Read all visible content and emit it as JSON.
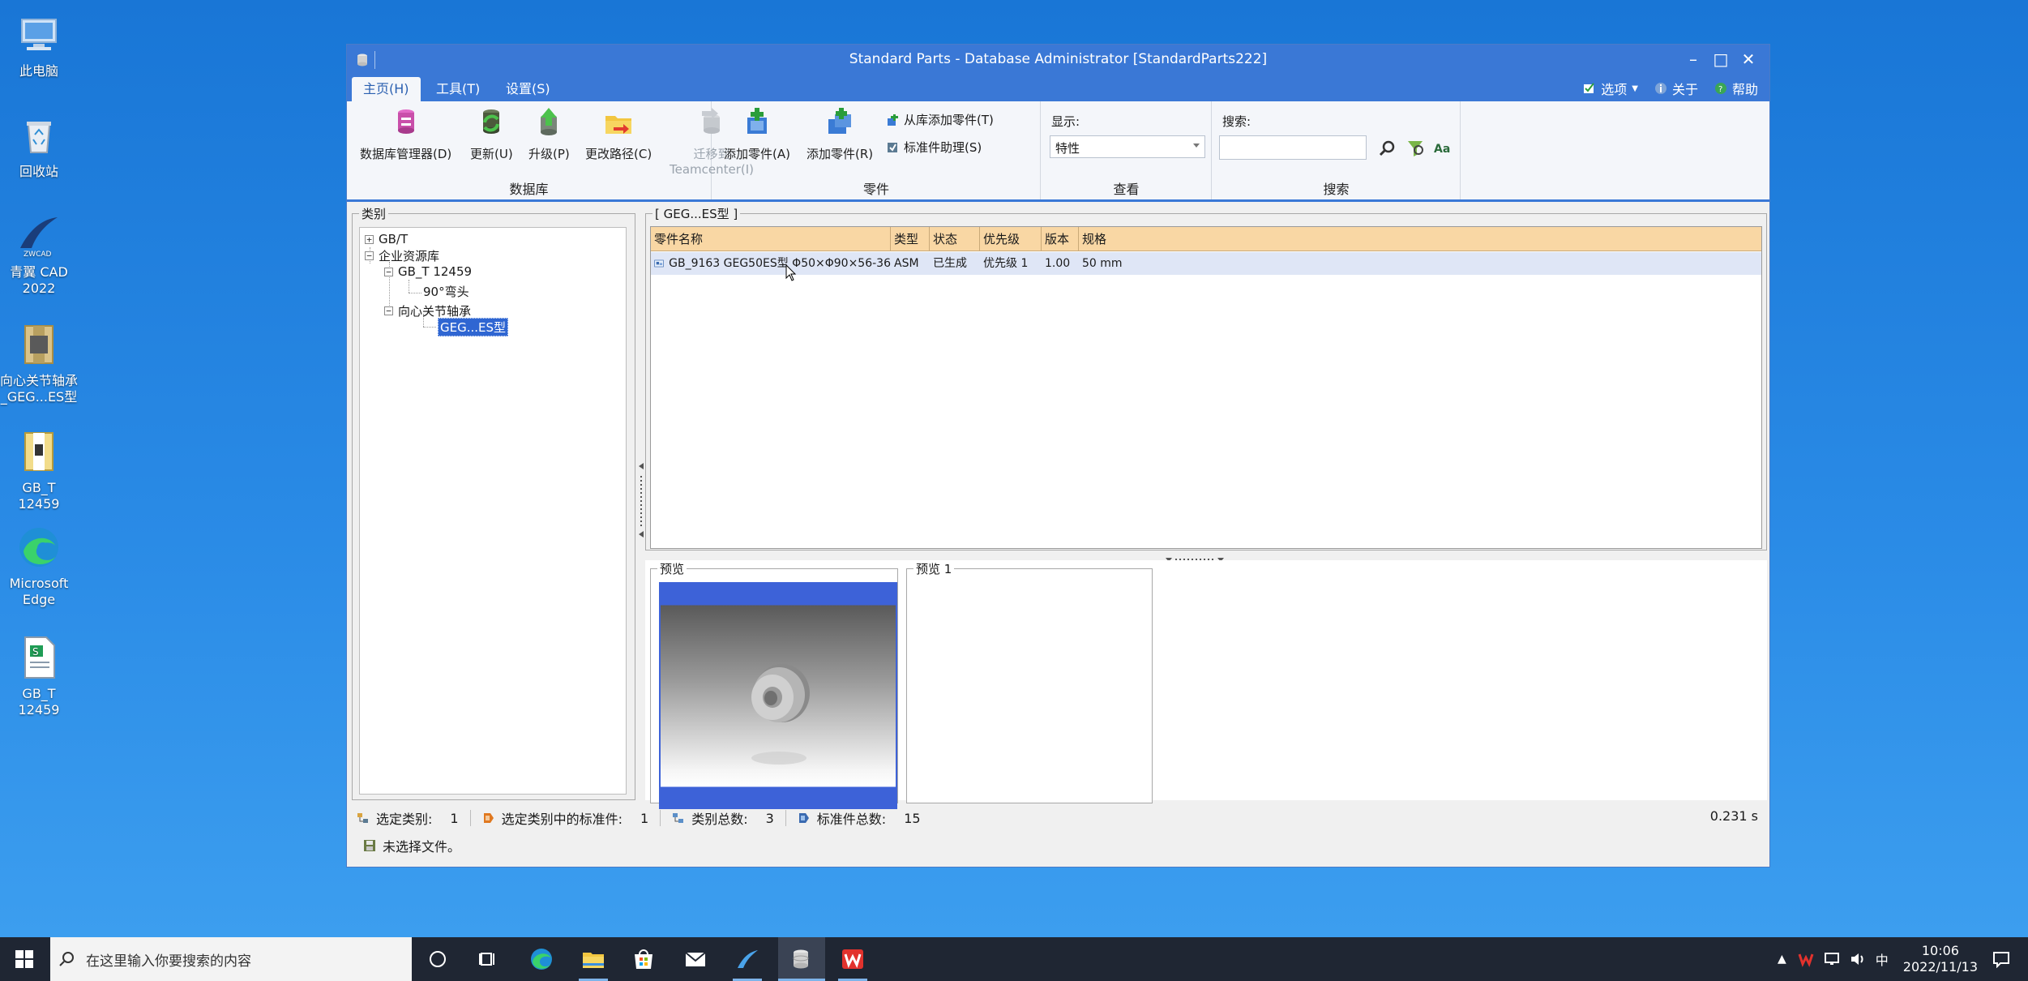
{
  "desktop": {
    "icons": [
      {
        "label": "此电脑",
        "icon": "computer-icon"
      },
      {
        "label": "回收站",
        "icon": "recycle-bin-icon"
      },
      {
        "label": "青翼 CAD 2022",
        "icon": "cad-app-icon"
      },
      {
        "label": "向心关节轴承_GEG...ES型",
        "icon": "archive-file-icon"
      },
      {
        "label": "GB_T 12459",
        "icon": "archive-file-icon"
      },
      {
        "label": "Microsoft Edge",
        "icon": "edge-icon"
      },
      {
        "label": "GB_T 12459",
        "icon": "spreadsheet-file-icon"
      }
    ]
  },
  "window": {
    "title": "Standard Parts - Database Administrator [StandardParts222]",
    "tabs": [
      "主页(H)",
      "工具(T)",
      "设置(S)"
    ],
    "active_tab": 0,
    "right_menu": {
      "options": "选项",
      "about": "关于",
      "help": "帮助"
    }
  },
  "ribbon": {
    "database": {
      "label": "数据库",
      "buttons": {
        "manager": "数据库管理器(D)",
        "update": "更新(U)",
        "upgrade": "升级(P)",
        "change_path": "更改路径(C)",
        "migrate_line1": "迁移到",
        "migrate_line2": "Teamcenter(I)"
      }
    },
    "parts": {
      "label": "零件",
      "add_part_a": "添加零件(A)",
      "add_part_r": "添加零件(R)",
      "add_from_lib": "从库添加零件(T)",
      "std_assistant": "标准件助理(S)"
    },
    "view": {
      "label": "查看",
      "display_label": "显示:",
      "display_value": "特性"
    },
    "search": {
      "label": "搜索",
      "search_label": "搜索:",
      "value": ""
    }
  },
  "category": {
    "title": "类别",
    "tree": {
      "gbt": "GB/T",
      "enterprise": "企业资源库",
      "gbt12459": "GB_T 12459",
      "elbow": "90°弯头",
      "bearing": "向心关节轴承",
      "geg": "GEG...ES型"
    }
  },
  "parts_list": {
    "title": "[ GEG...ES型 ]",
    "columns": [
      "零件名称",
      "类型",
      "状态",
      "优先级",
      "版本",
      "规格"
    ],
    "rows": [
      {
        "name": "GB_9163 GEG50ES型 Φ50×Φ90×56-36",
        "type": "ASM",
        "status": "已生成",
        "priority": "优先级 1",
        "version": "1.00",
        "spec": "50 mm"
      }
    ]
  },
  "previews": {
    "p0": "预览",
    "p1": "预览 1"
  },
  "status": {
    "selected_category_label": "选定类别:",
    "selected_category_value": "1",
    "std_in_category_label": "选定类别中的标准件:",
    "std_in_category_value": "1",
    "category_total_label": "类别总数:",
    "category_total_value": "3",
    "std_total_label": "标准件总数:",
    "std_total_value": "15",
    "time": "0.231 s",
    "file_status": "未选择文件。"
  },
  "taskbar": {
    "search_placeholder": "在这里输入你要搜索的内容",
    "time": "10:06",
    "date": "2022/11/13",
    "ime": "中"
  }
}
